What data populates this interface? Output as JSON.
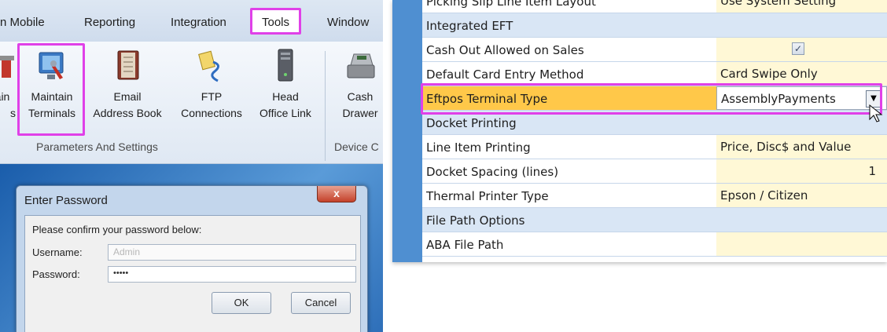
{
  "ribbon": {
    "tabs": [
      {
        "label": "n Mobile"
      },
      {
        "label": "Reporting"
      },
      {
        "label": "Integration"
      },
      {
        "label": "Tools"
      },
      {
        "label": "Window"
      }
    ],
    "buttons": [
      {
        "line1": "ain",
        "line2": "s"
      },
      {
        "line1": "Maintain",
        "line2": "Terminals"
      },
      {
        "line1": "Email",
        "line2": "Address Book"
      },
      {
        "line1": "FTP",
        "line2": "Connections"
      },
      {
        "line1": "Head",
        "line2": "Office Link"
      },
      {
        "line1": "Cash",
        "line2": "Drawer"
      }
    ],
    "groups": [
      {
        "label": "Parameters And Settings"
      },
      {
        "label": "Device C"
      }
    ]
  },
  "dialog": {
    "title": "Enter Password",
    "close_label": "x",
    "prompt": "Please confirm your password below:",
    "username_label": "Username:",
    "username_value": "Admin",
    "password_label": "Password:",
    "password_value": "•••••",
    "ok_label": "OK",
    "cancel_label": "Cancel"
  },
  "grid": {
    "rows": [
      {
        "name": "Picking Slip Line Item Layout",
        "value": "Use System Setting"
      },
      {
        "name": "Integrated EFT",
        "value": ""
      },
      {
        "name": "Cash Out Allowed on Sales",
        "value": "✓"
      },
      {
        "name": "Default Card Entry Method",
        "value": "Card Swipe Only"
      },
      {
        "name": "Eftpos Terminal Type",
        "value": "AssemblyPayments"
      },
      {
        "name": "Docket Printing",
        "value": ""
      },
      {
        "name": "Line Item Printing",
        "value": "Price, Disc$ and Value"
      },
      {
        "name": "Docket Spacing (lines)",
        "value": "1"
      },
      {
        "name": "Thermal Printer Type",
        "value": "Epson / Citizen"
      },
      {
        "name": "File Path Options",
        "value": ""
      },
      {
        "name": "ABA File Path",
        "value": ""
      }
    ],
    "dropdown_arrow": "▼"
  },
  "colors": {
    "highlight": "#e040e8",
    "selected_row": "#ffc849",
    "value_cell": "#fff8d6",
    "category_row": "#d9e6f5"
  }
}
